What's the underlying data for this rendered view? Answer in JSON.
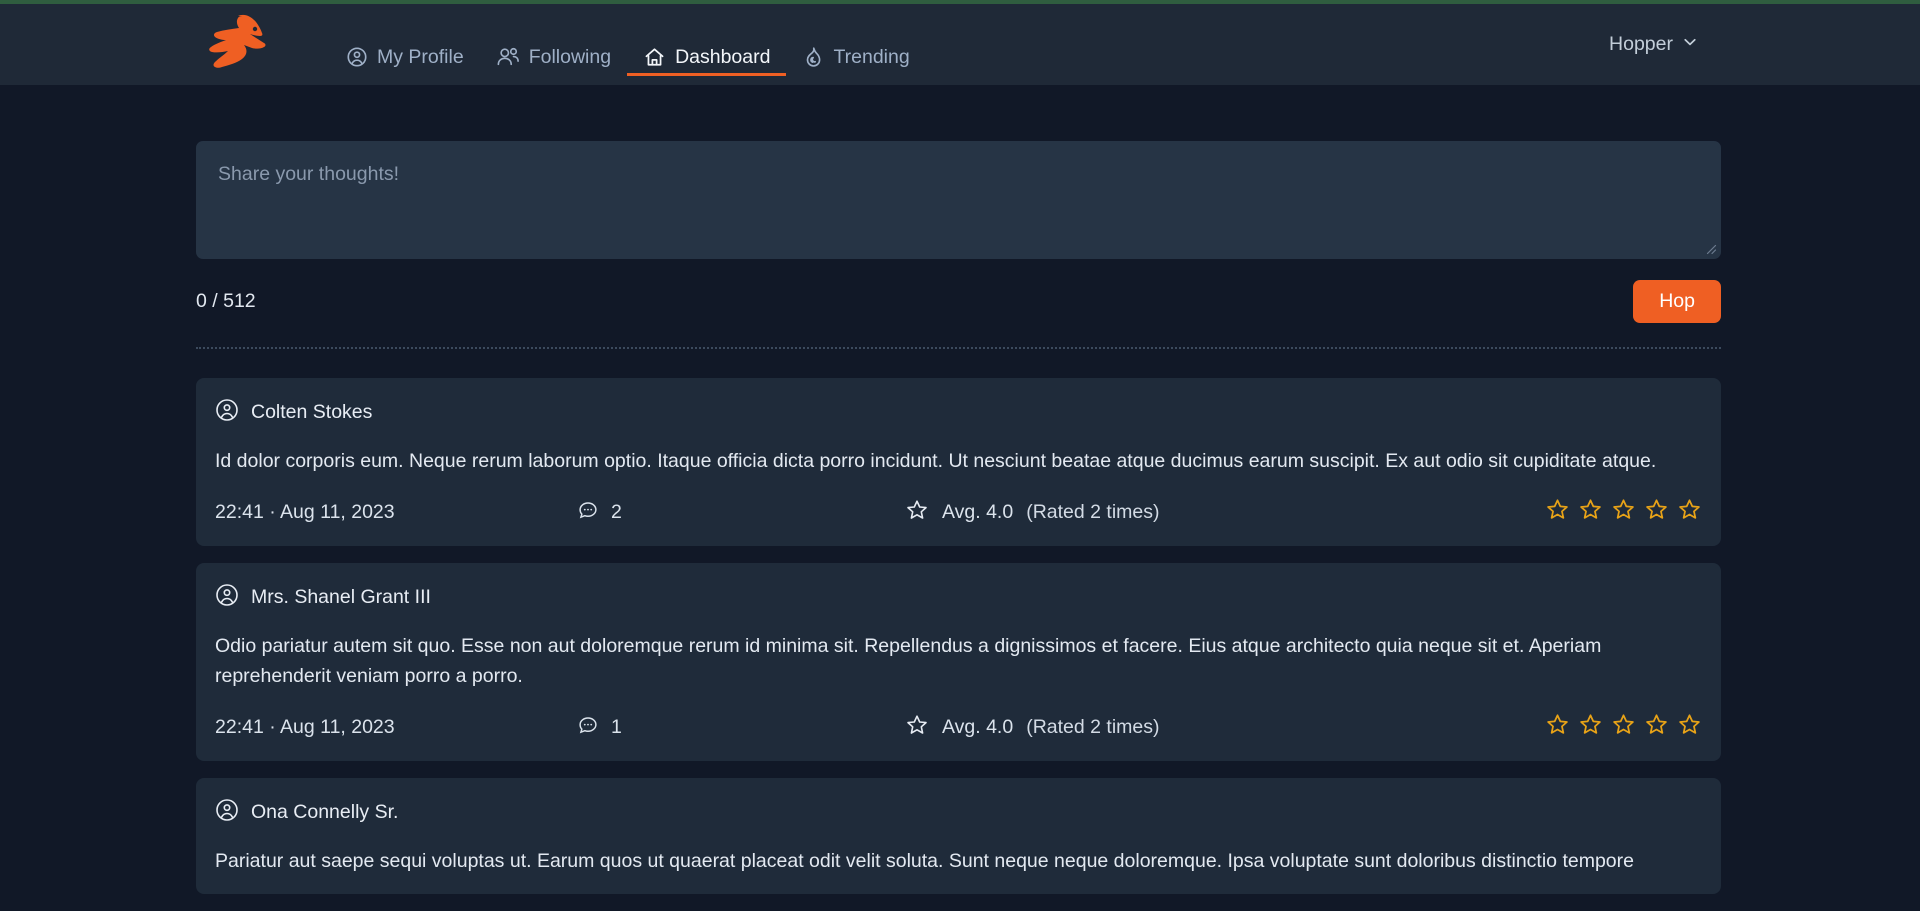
{
  "brand": {
    "logo_icon": "rabbit-logo-icon",
    "accent_color": "#ef5f23"
  },
  "navbar": {
    "items": [
      {
        "label": "My Profile",
        "icon": "user-circle-icon",
        "active": false
      },
      {
        "label": "Following",
        "icon": "users-icon",
        "active": false
      },
      {
        "label": "Dashboard",
        "icon": "home-icon",
        "active": true
      },
      {
        "label": "Trending",
        "icon": "flame-icon",
        "active": false
      }
    ],
    "account": {
      "label": "Hopper",
      "icon": "chevron-down-icon"
    }
  },
  "composer": {
    "placeholder": "Share your thoughts!",
    "value": "",
    "char_counter": "0 / 512",
    "submit_label": "Hop"
  },
  "feed": {
    "posts": [
      {
        "author": "Colten Stokes",
        "body": "Id dolor corporis eum. Neque rerum laborum optio. Itaque officia dicta porro incidunt. Ut nesciunt beatae atque ducimus earum suscipit. Ex aut odio sit cupiditate atque.",
        "timestamp": "22:41 · Aug 11, 2023",
        "comment_count": "2",
        "rating_avg": "Avg. 4.0",
        "rating_count": "(Rated 2 times)",
        "stars": 5,
        "stars_filled": 0
      },
      {
        "author": "Mrs. Shanel Grant III",
        "body": "Odio pariatur autem sit quo. Esse non aut doloremque rerum id minima sit. Repellendus a dignissimos et facere. Eius atque architecto quia neque sit et. Aperiam reprehenderit veniam porro a porro.",
        "timestamp": "22:41 · Aug 11, 2023",
        "comment_count": "1",
        "rating_avg": "Avg. 4.0",
        "rating_count": "(Rated 2 times)",
        "stars": 5,
        "stars_filled": 0
      },
      {
        "author": "Ona Connelly Sr.",
        "body": "Pariatur aut saepe sequi voluptas ut. Earum quos ut quaerat placeat odit velit soluta. Sunt neque neque doloremque. Ipsa voluptate sunt doloribus distinctio tempore",
        "timestamp": "",
        "comment_count": "",
        "rating_avg": "",
        "rating_count": "",
        "stars": 0,
        "stars_filled": 0
      }
    ]
  },
  "colors": {
    "page_bg": "#111827",
    "nav_bg": "#1f2937",
    "card_bg": "#1f2b3a",
    "composer_bg": "#263445",
    "accent": "#ef5f23",
    "star": "#e8a317",
    "top_strip": "#2f5d3f"
  }
}
